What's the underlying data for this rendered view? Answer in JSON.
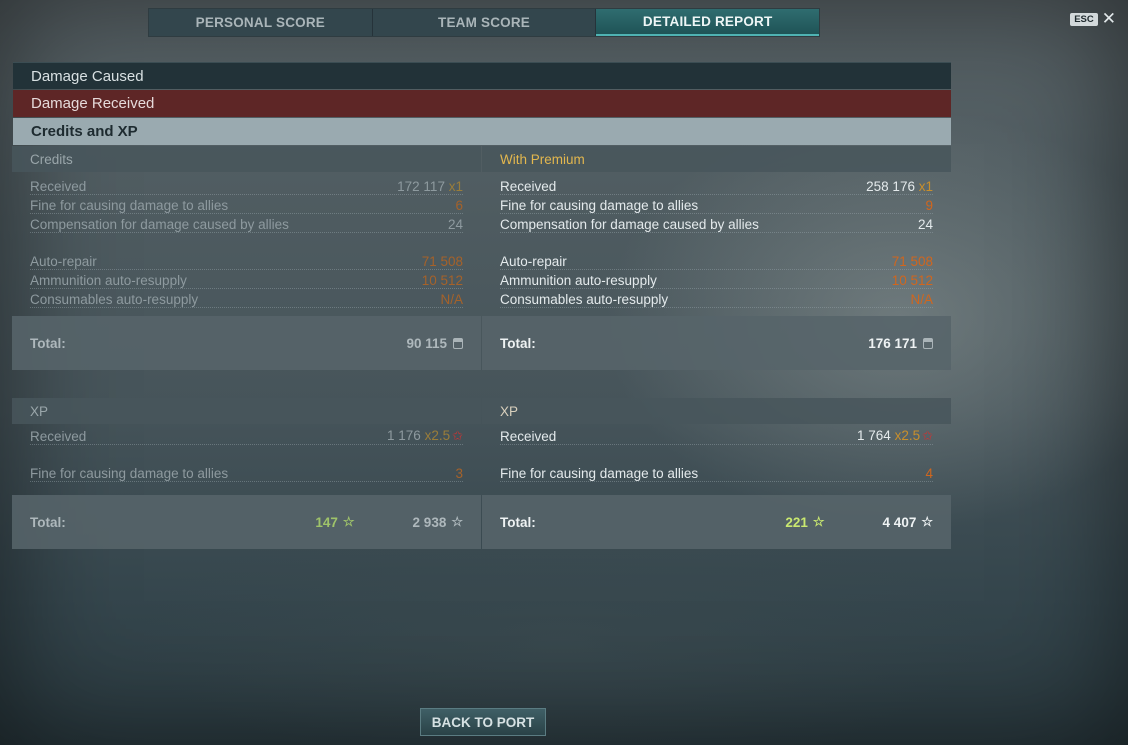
{
  "tabs": [
    {
      "label": "PERSONAL SCORE"
    },
    {
      "label": "TEAM SCORE"
    },
    {
      "label": "DETAILED REPORT"
    }
  ],
  "esc": {
    "key": "ESC",
    "close_icon": "close-icon"
  },
  "sections": {
    "damage_caused": "Damage Caused",
    "damage_received": "Damage Received",
    "credits_xp": "Credits and XP"
  },
  "credits": {
    "left": {
      "title": "Credits",
      "received_label": "Received",
      "received_value": "172 117",
      "received_mult": "x1",
      "fine_label": "Fine for causing damage to allies",
      "fine_value": "6",
      "comp_label": "Compensation for damage caused by allies",
      "comp_value": "24",
      "repair_label": "Auto-repair",
      "repair_value": "71 508",
      "ammo_label": "Ammunition auto-resupply",
      "ammo_value": "10 512",
      "cons_label": "Consumables auto-resupply",
      "cons_value": "N/A",
      "total_label": "Total:",
      "total_value": "90 115"
    },
    "right": {
      "title": "With Premium",
      "received_label": "Received",
      "received_value": "258 176",
      "received_mult": "x1",
      "fine_label": "Fine for causing damage to allies",
      "fine_value": "9",
      "comp_label": "Compensation for damage caused by allies",
      "comp_value": "24",
      "repair_label": "Auto-repair",
      "repair_value": "71 508",
      "ammo_label": "Ammunition auto-resupply",
      "ammo_value": "10 512",
      "cons_label": "Consumables auto-resupply",
      "cons_value": "N/A",
      "total_label": "Total:",
      "total_value": "176 171"
    }
  },
  "xp": {
    "left": {
      "title": "XP",
      "received_label": "Received",
      "received_value": "1 176",
      "received_mult": "x2.5",
      "fine_label": "Fine for causing damage to allies",
      "fine_value": "3",
      "total_label": "Total:",
      "total_free": "147",
      "total_xp": "2 938"
    },
    "right": {
      "title": "XP",
      "received_label": "Received",
      "received_value": "1 764",
      "received_mult": "x2.5",
      "fine_label": "Fine for causing damage to allies",
      "fine_value": "4",
      "total_label": "Total:",
      "total_free": "221",
      "total_xp": "4 407"
    }
  },
  "footer": {
    "back_label": "BACK TO PORT"
  },
  "colors": {
    "accent": "#2f6d70",
    "damage_received": "#5e2626",
    "penalty": "#d0661e",
    "premium": "#e3b74e"
  }
}
